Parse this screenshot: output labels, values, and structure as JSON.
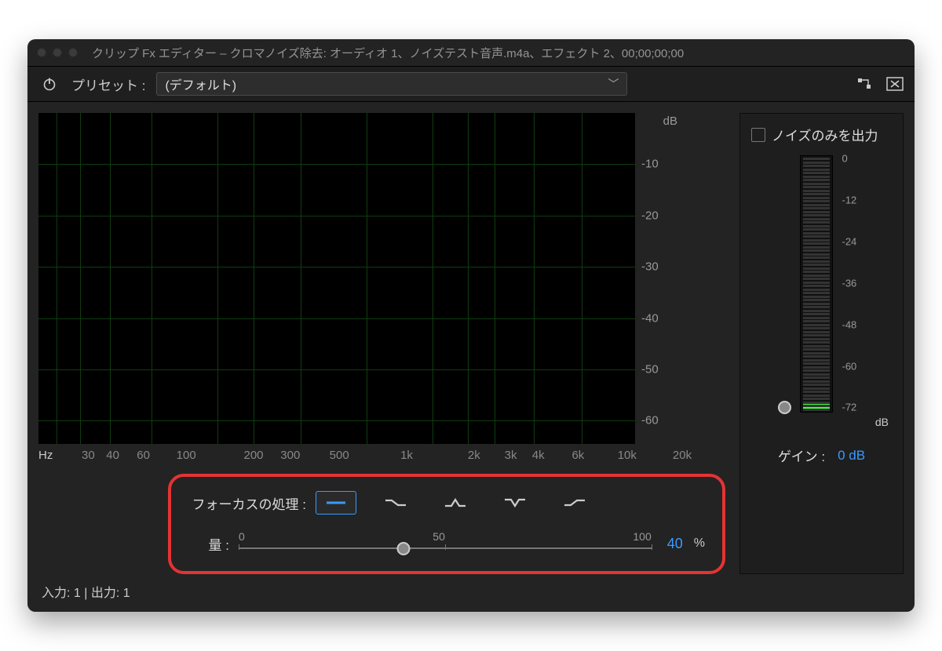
{
  "window": {
    "title": "クリップ Fx エディター – クロマノイズ除去: オーディオ 1、ノイズテスト音声.m4a、エフェクト 2、00;00;00;00"
  },
  "toolbar": {
    "preset_label": "プリセット :",
    "preset_value": "(デフォルト)"
  },
  "spectrum": {
    "y_unit": "dB",
    "y_ticks": [
      "-10",
      "-20",
      "-30",
      "-40",
      "-50",
      "-60"
    ],
    "x_unit": "Hz",
    "x_ticks": [
      {
        "label": "30",
        "pos": 3
      },
      {
        "label": "40",
        "pos": 7
      },
      {
        "label": "60",
        "pos": 12
      },
      {
        "label": "100",
        "pos": 19
      },
      {
        "label": "200",
        "pos": 30
      },
      {
        "label": "300",
        "pos": 36
      },
      {
        "label": "500",
        "pos": 44
      },
      {
        "label": "1k",
        "pos": 55
      },
      {
        "label": "2k",
        "pos": 66
      },
      {
        "label": "3k",
        "pos": 72
      },
      {
        "label": "4k",
        "pos": 76.5
      },
      {
        "label": "6k",
        "pos": 83
      },
      {
        "label": "10k",
        "pos": 91
      },
      {
        "label": "20k",
        "pos": 100
      }
    ]
  },
  "focus": {
    "label": "フォーカスの処理 :",
    "icons": [
      "flat",
      "low-shelf",
      "peak-up",
      "peak-down",
      "high-shelf"
    ],
    "active_index": 0
  },
  "amount": {
    "label": "量 :",
    "scale": [
      "0",
      "50",
      "100"
    ],
    "value": 40,
    "unit": "%"
  },
  "right": {
    "noise_only_label": "ノイズのみを出力",
    "meter_ticks": [
      "0",
      "-12",
      "-24",
      "-36",
      "-48",
      "-60",
      "-72"
    ],
    "meter_unit": "dB",
    "gain_label": "ゲイン :",
    "gain_value": "0 dB"
  },
  "footer": {
    "io": "入力: 1 | 出力: 1"
  }
}
